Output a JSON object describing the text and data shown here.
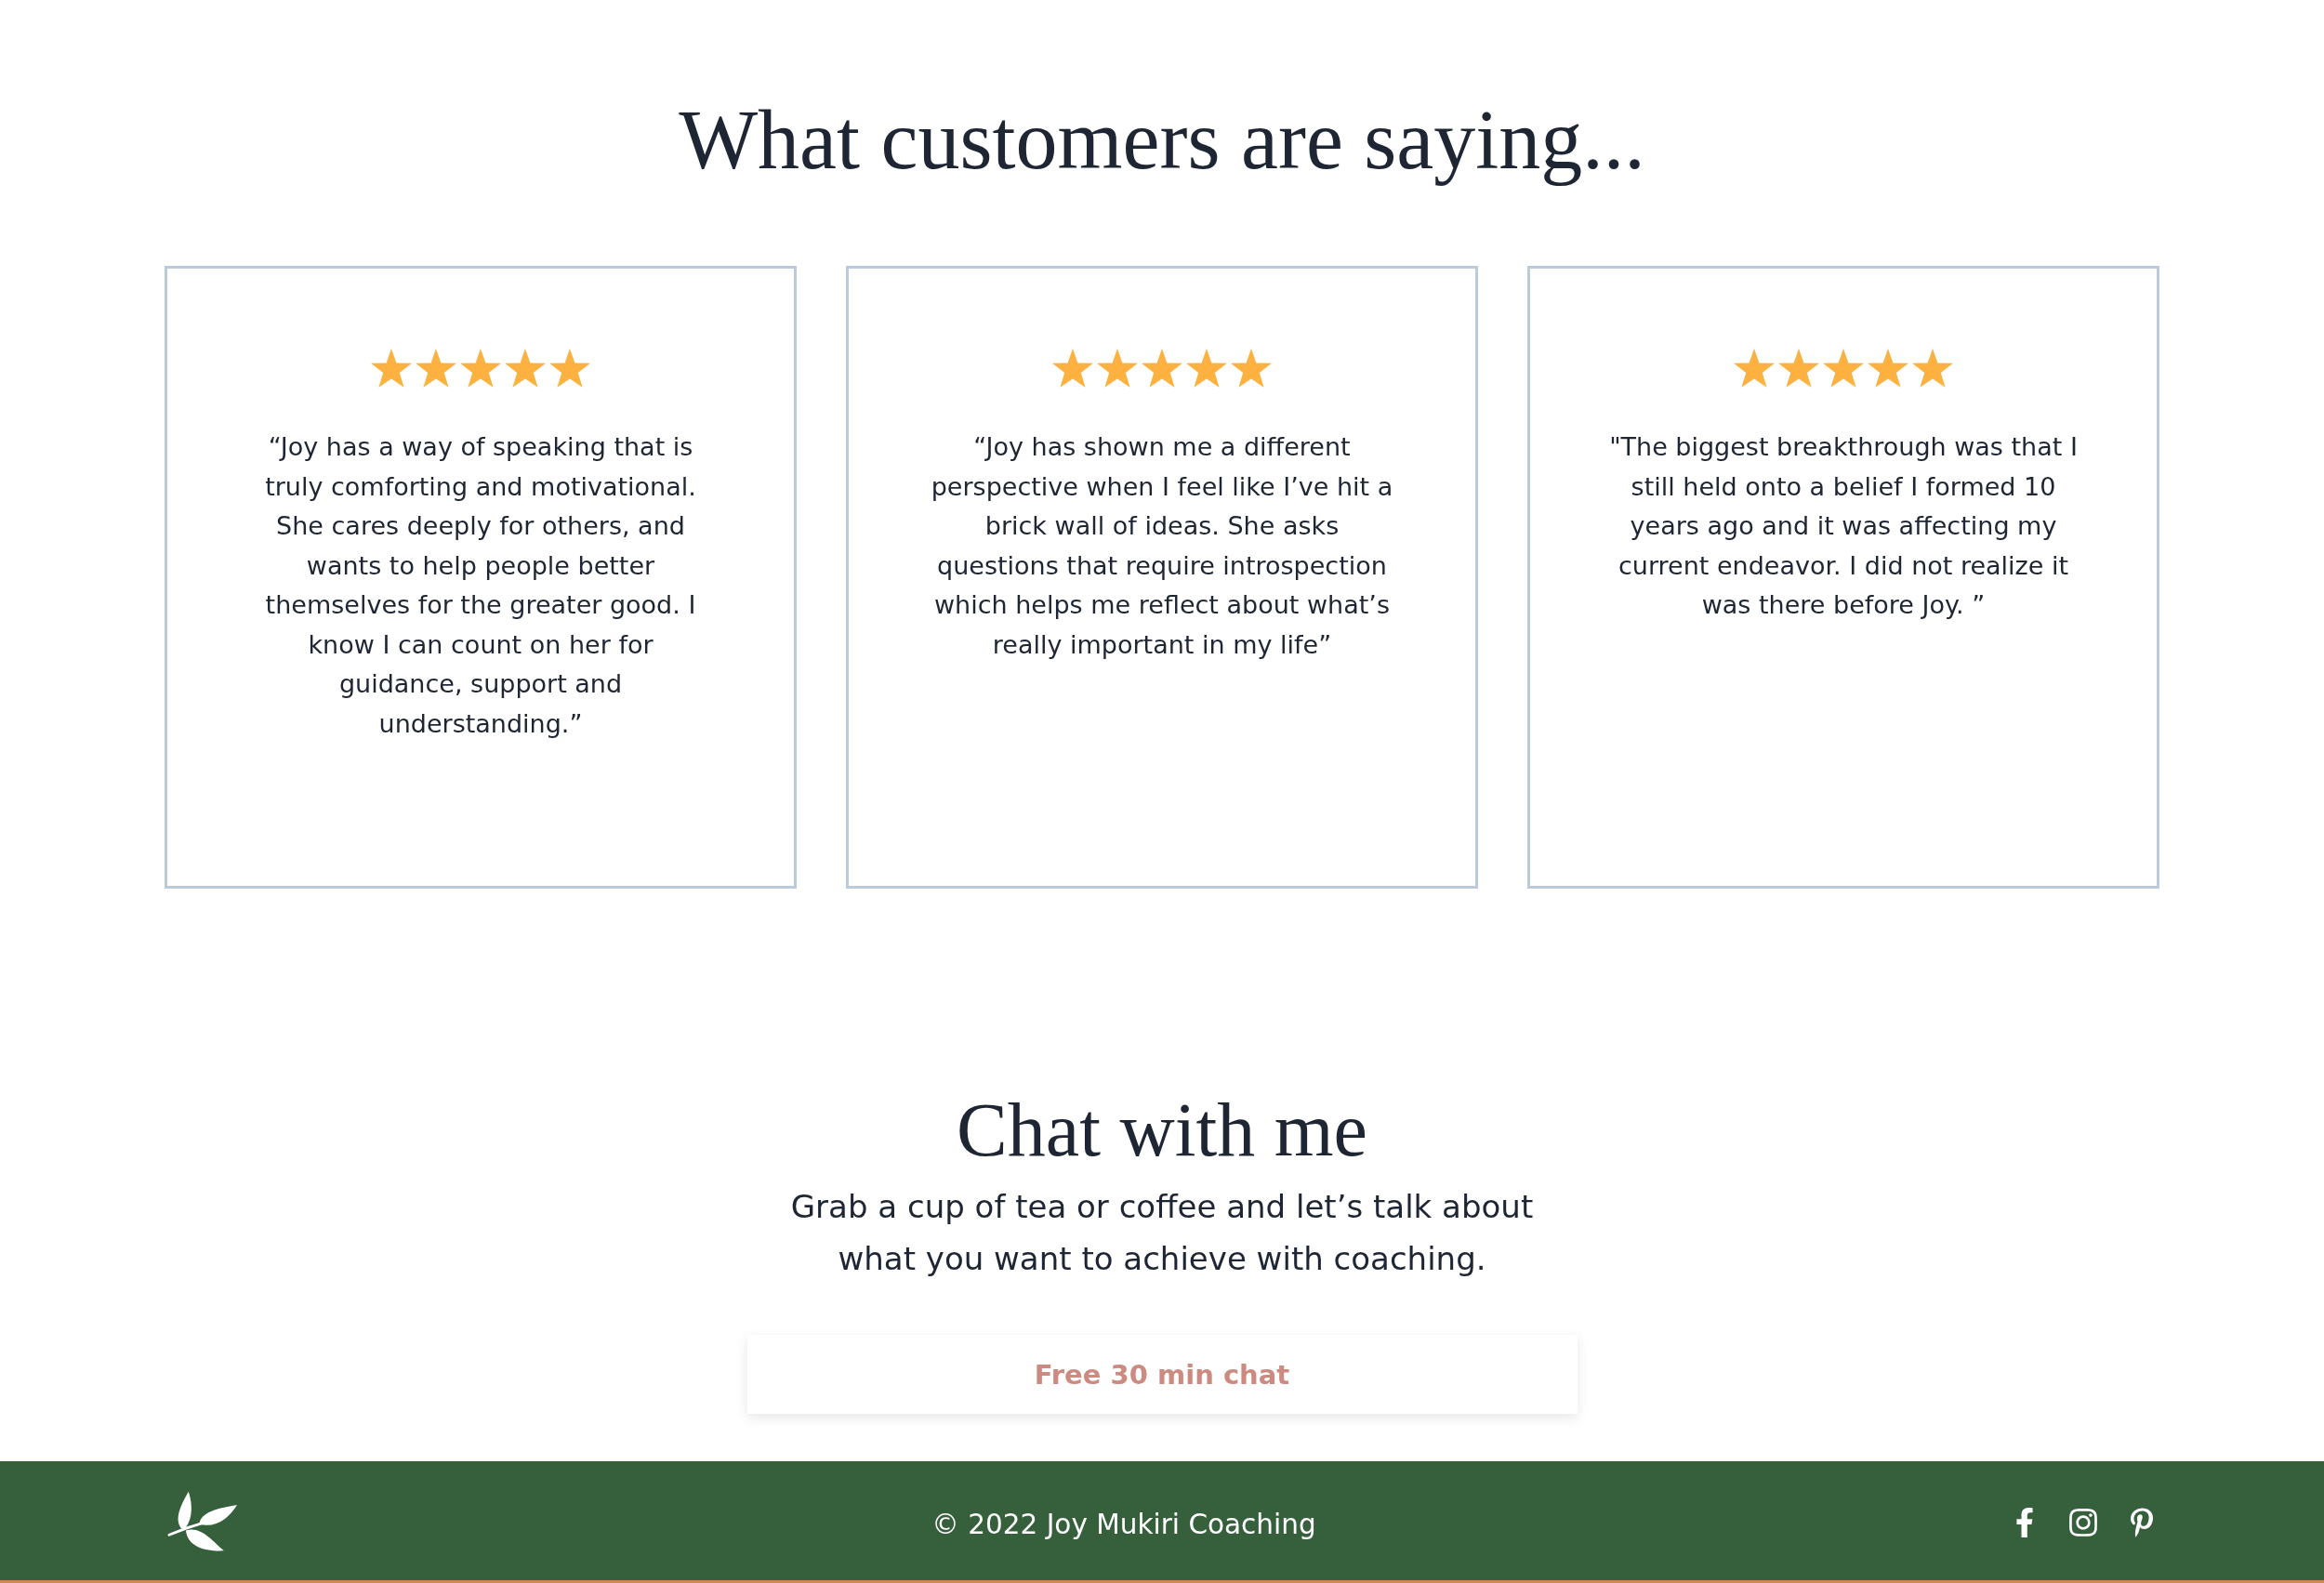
{
  "heading": "What customers are saying...",
  "testimonials": [
    {
      "stars": 5,
      "quote": "“Joy has a way of speaking that is truly comforting and motivational. She cares deeply for others, and wants to help people better themselves for the greater good. I know I can count on her for guidance, support and understanding.”"
    },
    {
      "stars": 5,
      "quote": "“Joy has shown me a different perspective when I feel like I’ve hit a brick wall of ideas. She asks questions that require introspection which helps me reflect about what’s really important in my life”"
    },
    {
      "stars": 5,
      "quote": "\"The biggest breakthrough was that I still held onto a belief I formed 10 years ago and it was affecting my current endeavor. I did not realize it was there before Joy. ”"
    }
  ],
  "chat": {
    "title": "Chat with me",
    "text": "Grab a cup of tea or coffee and let’s talk about what you want to achieve with coaching.",
    "button": "Free 30 min chat"
  },
  "footer": {
    "copyright": "© 2022 Joy Mukiri Coaching"
  }
}
